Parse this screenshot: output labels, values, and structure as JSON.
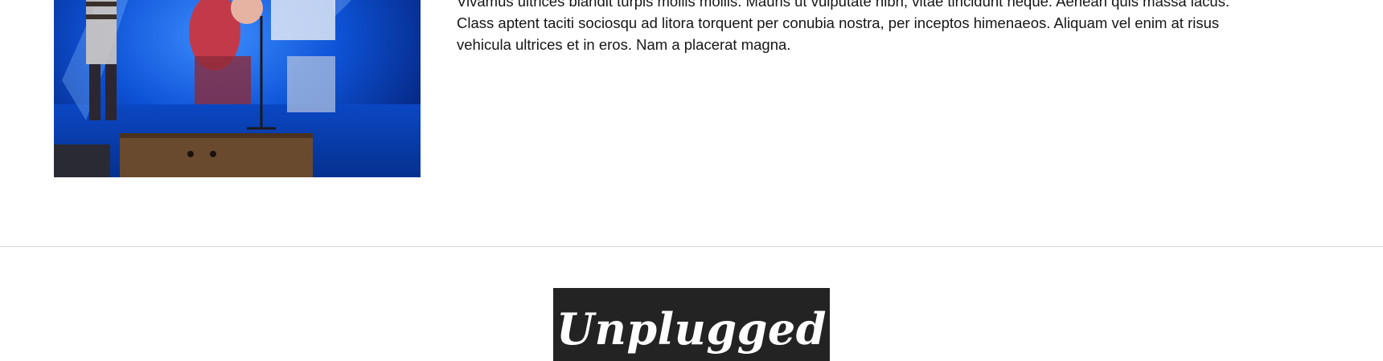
{
  "article": {
    "image": {
      "description_icon": "concert-photo"
    },
    "paragraph_lines": [
      "Vivamus ultrices blandit turpis mollis mollis. Mauris ut vulputate nibh, vitae tincidunt neque. Aenean quis massa lacus.",
      "Class aptent taciti sociosqu ad litora torquent per conubia nostra, per inceptos himenaeos. Aliquam vel enim at risus",
      "vehicula ultrices et in eros. Nam a placerat magna."
    ]
  },
  "footer": {
    "logo_text": "Unplugged"
  },
  "colors": {
    "logo_background": "#232323",
    "divider": "#d6d6d6",
    "photo_blue": "#0a3fb0"
  }
}
